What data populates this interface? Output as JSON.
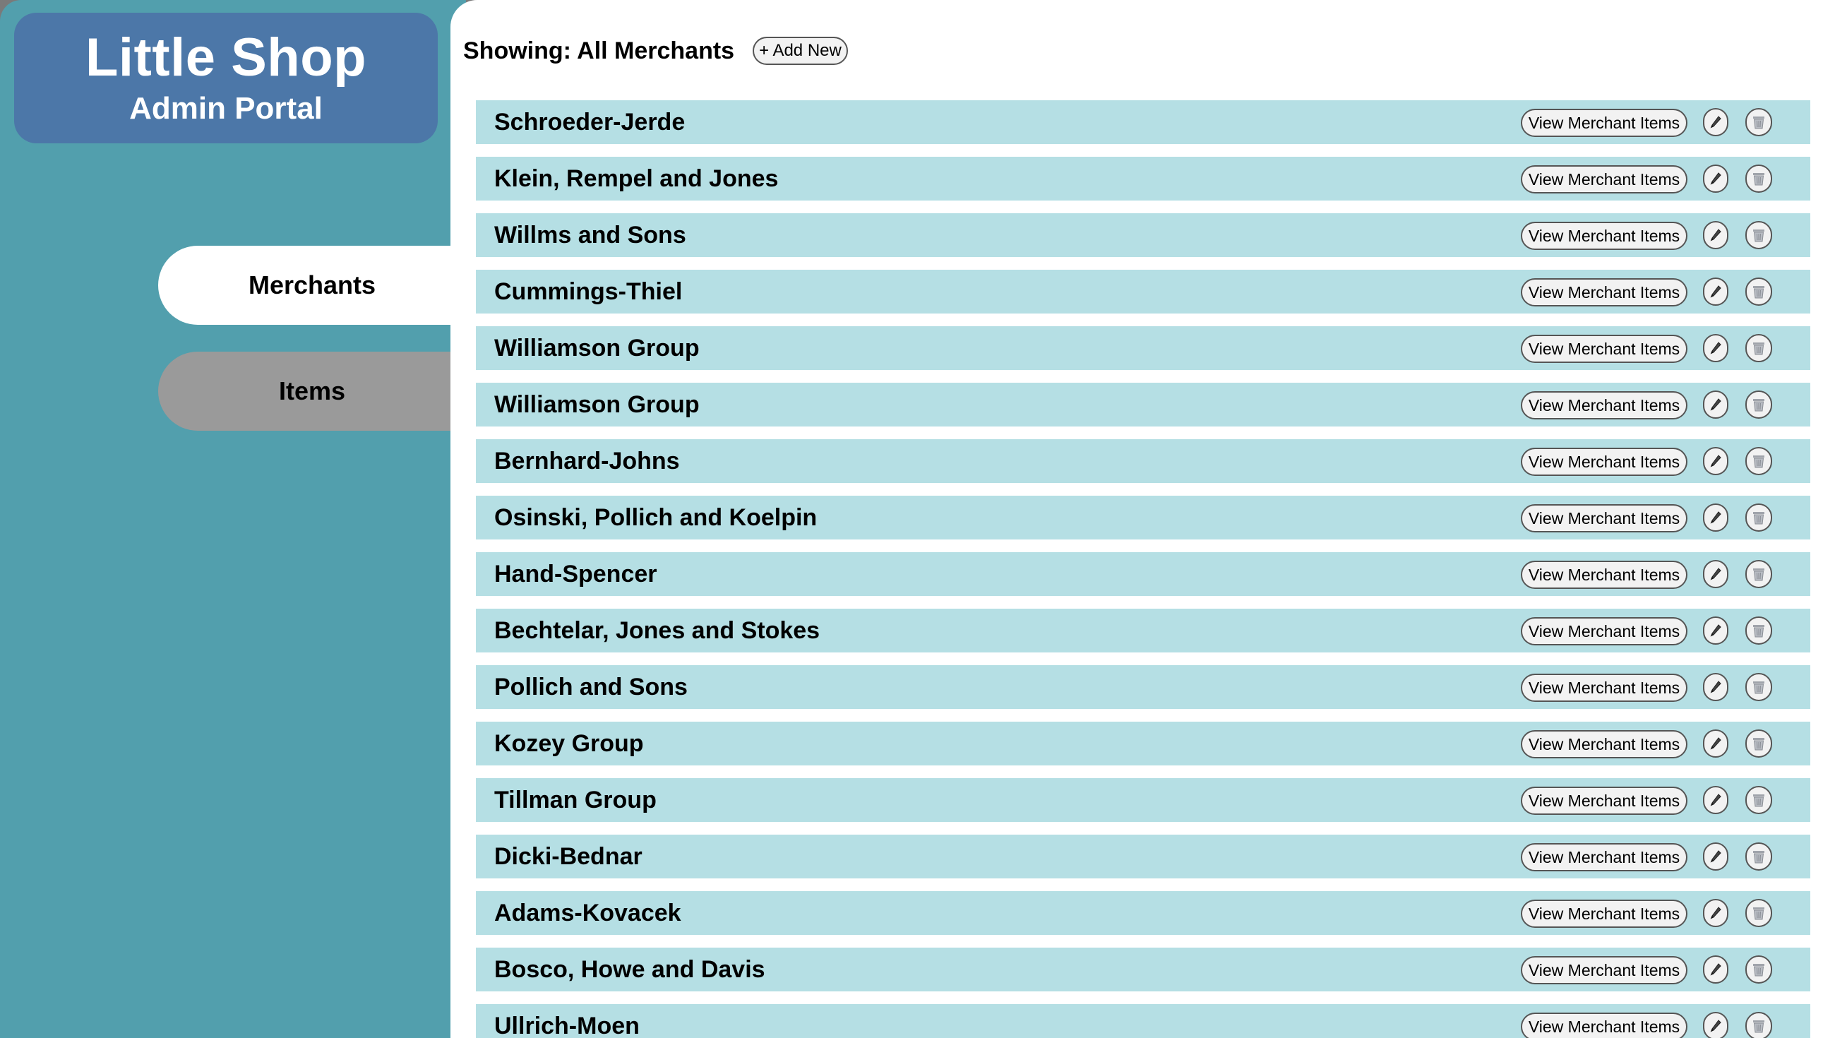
{
  "brand": {
    "title": "Little Shop",
    "subtitle": "Admin Portal",
    "color": "#4c77a8"
  },
  "sidebar": {
    "color": "#529fad",
    "items": [
      {
        "label": "Merchants",
        "active": true
      },
      {
        "label": "Items",
        "active": false
      }
    ]
  },
  "header": {
    "showing_label": "Showing: All Merchants",
    "add_button_label": "+ Add New"
  },
  "list": {
    "row_color": "#b5dfe4",
    "view_button_label": "View Merchant Items",
    "edit_icon": "pencil-icon",
    "delete_icon": "trash-icon",
    "merchants": [
      "Schroeder-Jerde",
      "Klein, Rempel and Jones",
      "Willms and Sons",
      "Cummings-Thiel",
      "Williamson Group",
      "Williamson Group",
      "Bernhard-Johns",
      "Osinski, Pollich and Koelpin",
      "Hand-Spencer",
      "Bechtelar, Jones and Stokes",
      "Pollich and Sons",
      "Kozey Group",
      "Tillman Group",
      "Dicki-Bednar",
      "Adams-Kovacek",
      "Bosco, Howe and Davis",
      "Ullrich-Moen"
    ]
  }
}
